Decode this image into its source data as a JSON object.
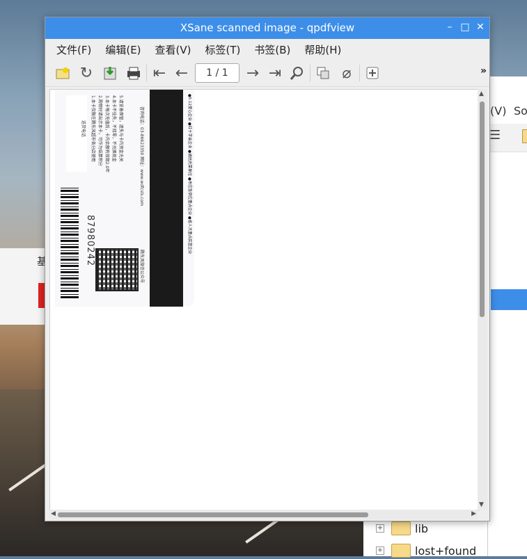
{
  "window": {
    "title": "XSane scanned image - qpdfview",
    "controls": {
      "minimize": "–",
      "maximize": "□",
      "close": "✕"
    }
  },
  "menu": [
    {
      "label": "文件(F)"
    },
    {
      "label": "编辑(E)"
    },
    {
      "label": "查看(V)"
    },
    {
      "label": "标签(T)"
    },
    {
      "label": "书签(B)"
    },
    {
      "label": "帮助(H)"
    }
  ],
  "toolbar": {
    "icons": [
      "open-icon",
      "refresh-icon",
      "save-icon",
      "print-icon",
      "first-page-icon",
      "previous-page-icon",
      "next-page-icon",
      "last-page-icon",
      "search-icon",
      "copy-icon",
      "attachment-icon",
      "add-tab-icon"
    ],
    "page_indicator": "1 / 1",
    "overflow": "»"
  },
  "document": {
    "card_number": "87980242",
    "card_lines": [
      "送货电话",
      "1.本卡仅限在腾东风超市各分店使用",
      "2.购物时请出示本卡，可作为结算积分",
      "3.本卡每次充值后，卡内余额有效期2.0年",
      "4.本卡不挂失，不找零，不兑换现金",
      "5.请妥善保管，遗失与卡内资金无关",
      "咨询电话：03-86623350  网址：www.wdfcsls.com",
      "腾东风微信公众号",
      "●5.12爱心企业 ●红十字会企业 ●诚信光荣单位 ●市应急供应重点企业 ●省人大重点民营企业"
    ]
  },
  "background": {
    "right_window": {
      "menu_v": "(V)",
      "menu_so": "So"
    },
    "files": [
      {
        "name": "lib"
      },
      {
        "name": "lost+found"
      }
    ],
    "left_window_label": "基"
  }
}
